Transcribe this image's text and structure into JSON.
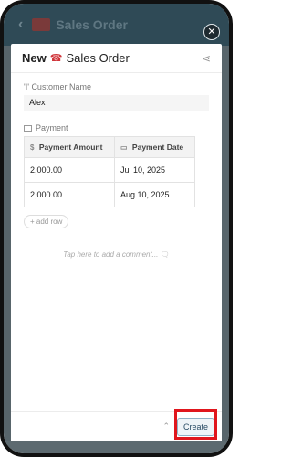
{
  "background": {
    "title": "Sales Order",
    "back_icon": "chevron-left-icon"
  },
  "close_label": "✕",
  "sheet": {
    "new_label": "New",
    "record_icon": "sales-order-icon",
    "record_name": "Sales Order",
    "share_icon": "share-icon"
  },
  "customer": {
    "label": "'I' Customer Name",
    "value": "Alex"
  },
  "payment_section": {
    "label": "Payment",
    "columns": [
      {
        "icon": "$",
        "label": "Payment Amount"
      },
      {
        "icon": "▭",
        "label": "Payment Date"
      }
    ],
    "rows": [
      {
        "amount": "2,000.00",
        "date": "Jul 10, 2025"
      },
      {
        "amount": "2,000.00",
        "date": "Aug 10, 2025"
      }
    ],
    "add_row": "+ add row"
  },
  "comment_placeholder": "Tap here to add a comment...",
  "footer": {
    "create_label": "Create",
    "up_icon": "caret-up-icon"
  },
  "colors": {
    "accent_red": "#e0161d",
    "app_bar": "#2f4a56",
    "create_border": "#8fb2c7"
  }
}
